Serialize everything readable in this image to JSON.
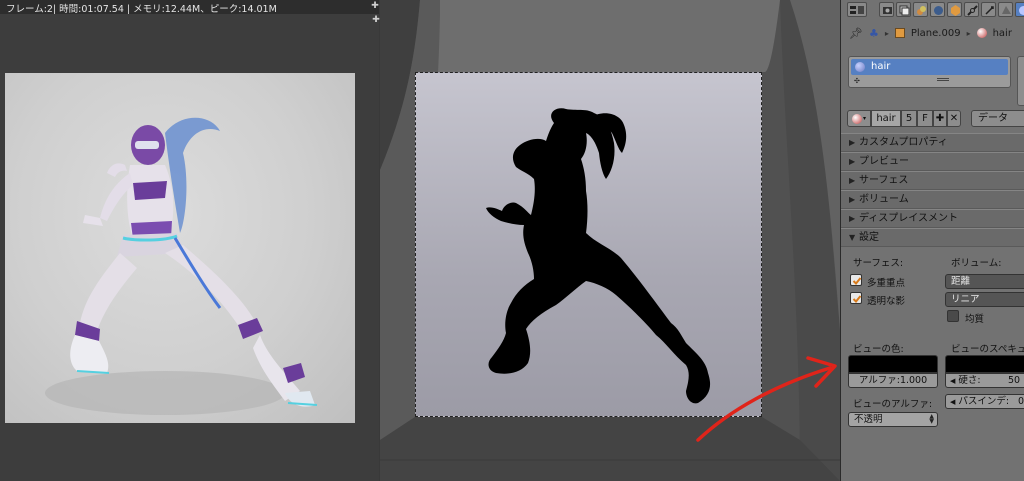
{
  "render": {
    "header_text": "フレーム:2| 時間:01:07.54 | メモリ:12.44M、ピーク:14.01M"
  },
  "properties": {
    "breadcrumb": {
      "object_name": "Plane.009",
      "material_name": "hair"
    },
    "slot": {
      "label": "hair"
    },
    "material_row": {
      "name": "hair",
      "users": "5",
      "fake_user": "F",
      "data_select": "データ"
    },
    "panels": [
      {
        "label": "カスタムプロパティ",
        "tri": "▶"
      },
      {
        "label": "プレビュー",
        "tri": "▶"
      },
      {
        "label": "サーフェス",
        "tri": "▶"
      },
      {
        "label": "ボリューム",
        "tri": "▶"
      },
      {
        "label": "ディスプレイスメント",
        "tri": "▶"
      },
      {
        "label": "設定",
        "tri": "▼"
      }
    ],
    "settings": {
      "surface_label": "サーフェス:",
      "volume_label": "ボリューム:",
      "multiple_importance": "多重重点",
      "transparent_shadows": "透明な影",
      "volume_sampling": "距離",
      "volume_interpolation": "リニア",
      "homogeneous": "均質",
      "viewport_color_label": "ビューの色:",
      "viewport_specular_label": "ビューのスペキュ",
      "alpha_field": "アルファ:1.000",
      "hardness_label": "硬さ:",
      "hardness_value": "50",
      "viewport_alpha_label": "ビューのアルファ:",
      "pass_index_label": "パスインデ:",
      "pass_index_value": "0",
      "blend_mode": "不透明"
    },
    "colors": {
      "selected_slot": "#5680c2",
      "annotation_arrow": "#e0241a"
    }
  }
}
